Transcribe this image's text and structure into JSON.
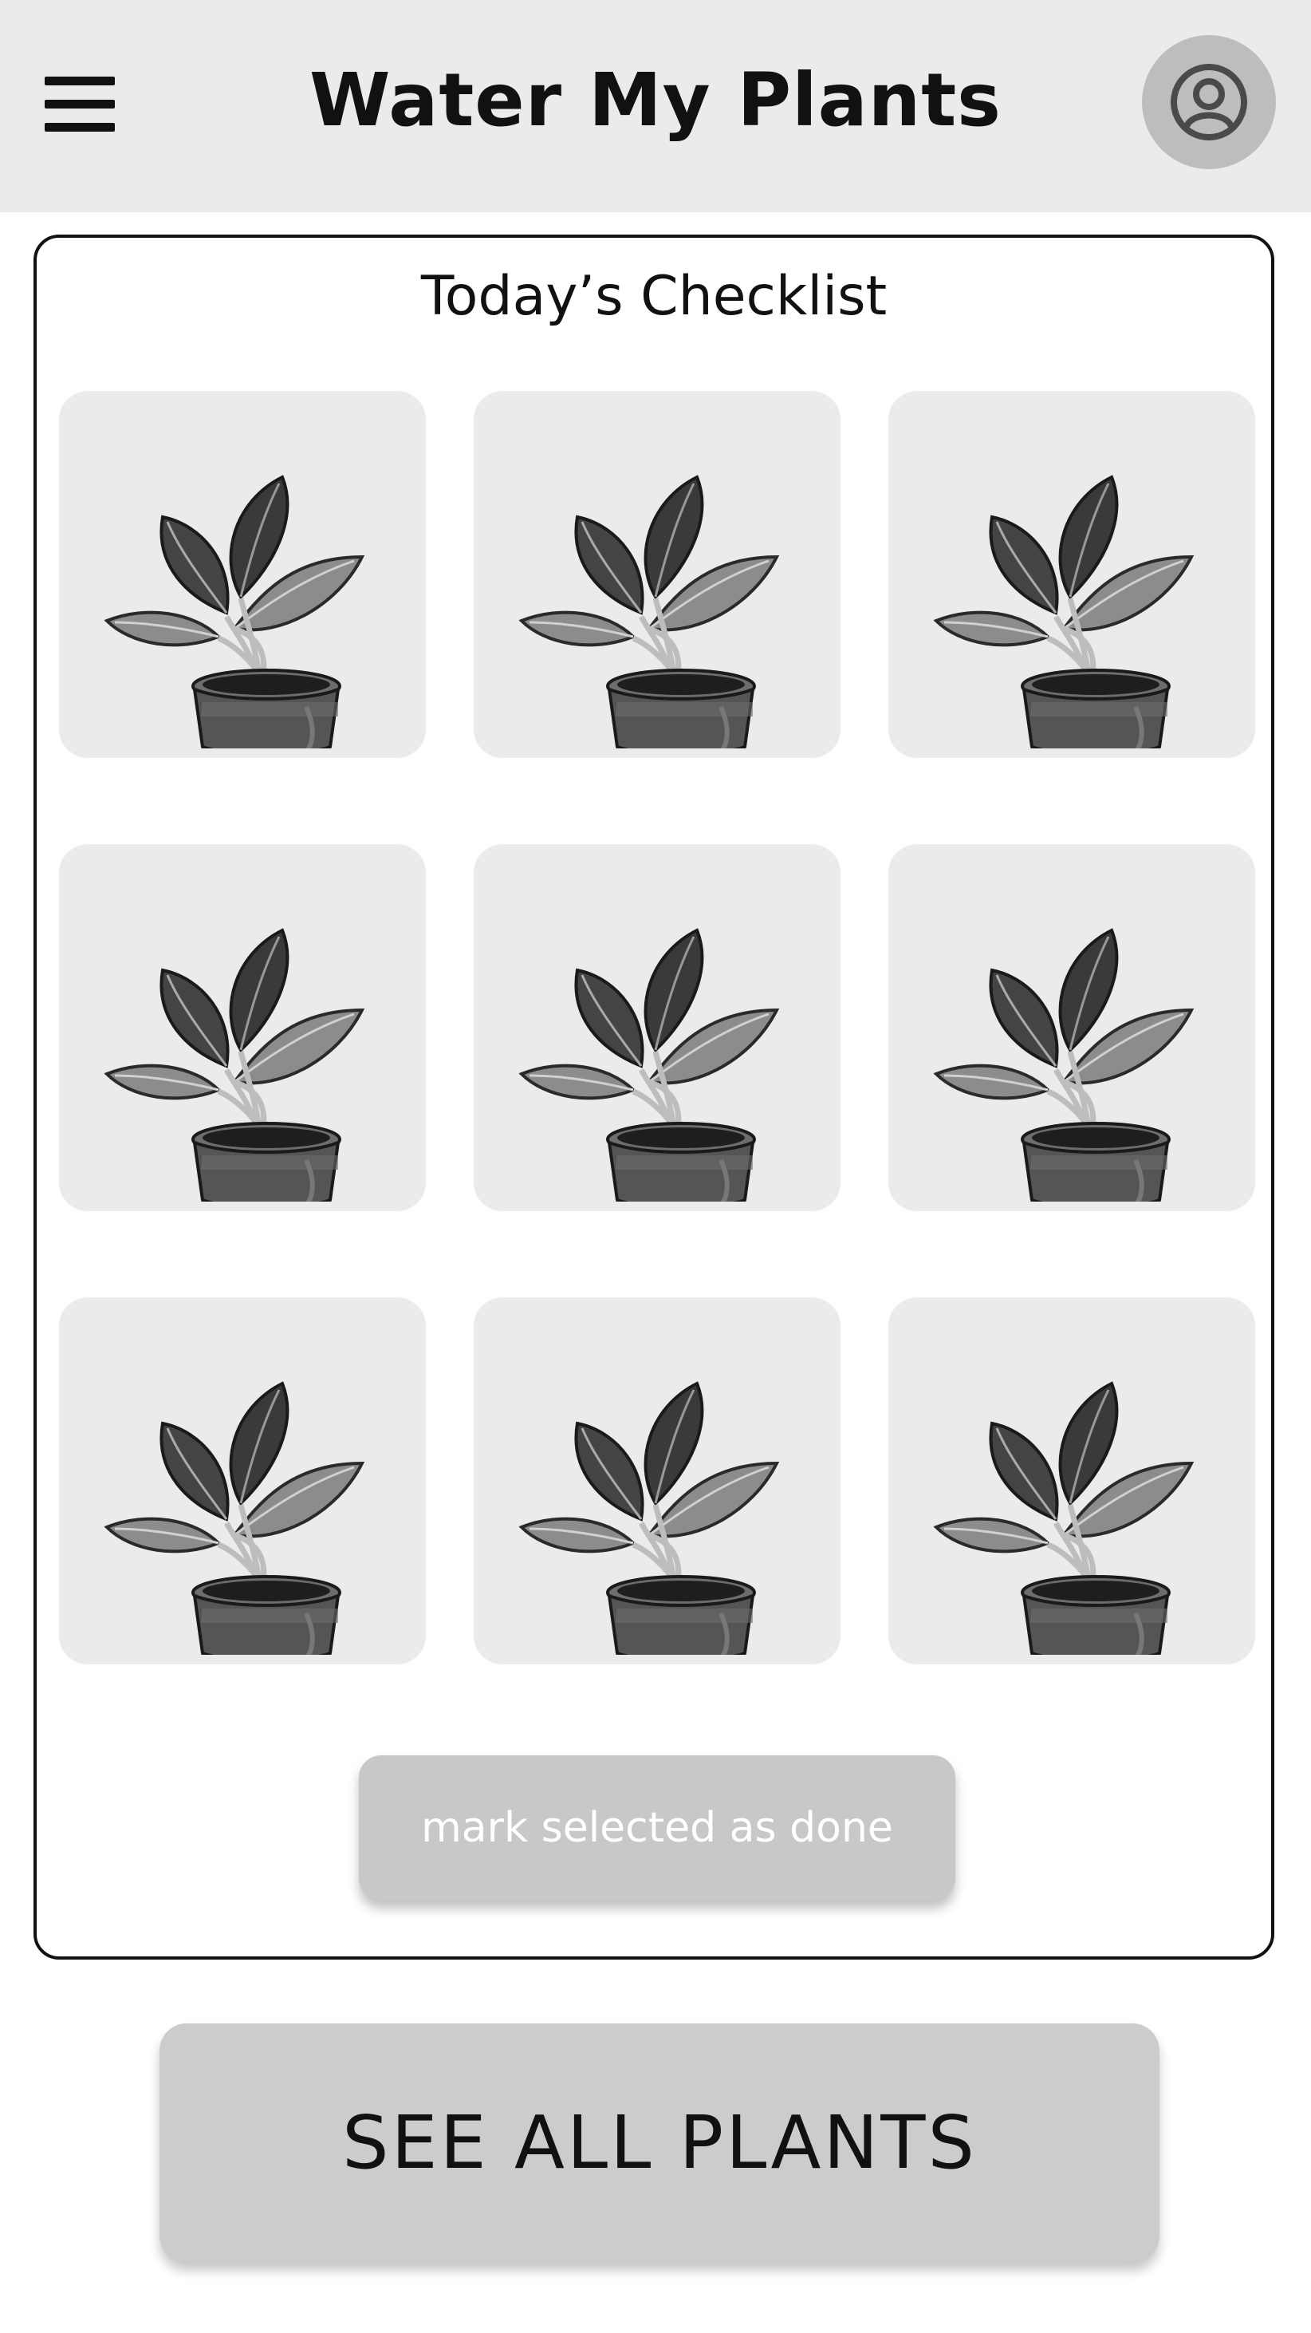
{
  "header": {
    "title": "Water My Plants",
    "menu_icon": "hamburger-menu-icon",
    "profile_icon": "user-avatar-icon"
  },
  "checklist": {
    "title": "Today’s Checklist",
    "plants": [
      {
        "icon": "potted-plant-icon"
      },
      {
        "icon": "potted-plant-icon"
      },
      {
        "icon": "potted-plant-icon"
      },
      {
        "icon": "potted-plant-icon"
      },
      {
        "icon": "potted-plant-icon"
      },
      {
        "icon": "potted-plant-icon"
      },
      {
        "icon": "potted-plant-icon"
      },
      {
        "icon": "potted-plant-icon"
      },
      {
        "icon": "potted-plant-icon"
      }
    ],
    "mark_done_label": "mark selected as done"
  },
  "see_all_label": "SEE ALL PLANTS",
  "colors": {
    "header_bg": "#ebebeb",
    "tile_bg": "#ebebeb",
    "button_bg": "#cccccc",
    "text": "#111111"
  }
}
